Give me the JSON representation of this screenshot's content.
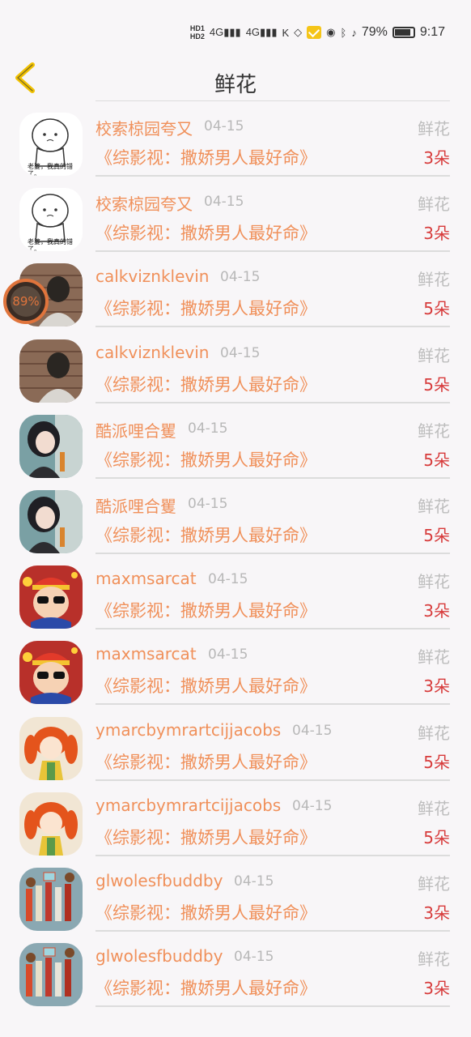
{
  "status_bar": {
    "hd1": "HD1",
    "hd2": "HD2",
    "sig1": "4G",
    "sig2": "4G",
    "battery": "79%",
    "time": "9:17"
  },
  "header": {
    "title": "鲜花"
  },
  "badge": {
    "percent": "89%"
  },
  "rows": [
    {
      "name": "",
      "date": "",
      "type": "",
      "work": "《综影视：撒娇男人最好命》",
      "count": "3朵",
      "avatar": "dark"
    },
    {
      "name": "校索椋园夸又",
      "date": "04-15",
      "type": "鲜花",
      "work": "《综影视：撒娇男人最好命》",
      "count": "3朵",
      "avatar": "meme",
      "avatar_text": "老婆，我真的错了。"
    },
    {
      "name": "校索椋园夸又",
      "date": "04-15",
      "type": "鲜花",
      "work": "《综影视：撒娇男人最好命》",
      "count": "3朵",
      "avatar": "meme",
      "avatar_text": "老婆，我真的错了。"
    },
    {
      "name": "calkviznklevin",
      "date": "04-15",
      "type": "鲜花",
      "work": "《综影视：撒娇男人最好命》",
      "count": "5朵",
      "avatar": "brick"
    },
    {
      "name": "calkviznklevin",
      "date": "04-15",
      "type": "鲜花",
      "work": "《综影视：撒娇男人最好命》",
      "count": "5朵",
      "avatar": "brick"
    },
    {
      "name": "酷派哩合矍",
      "date": "04-15",
      "type": "鲜花",
      "work": "《综影视：撒娇男人最好命》",
      "count": "5朵",
      "avatar": "girl"
    },
    {
      "name": "酷派哩合矍",
      "date": "04-15",
      "type": "鲜花",
      "work": "《综影视：撒娇男人最好命》",
      "count": "5朵",
      "avatar": "girl"
    },
    {
      "name": "maxmsarcat",
      "date": "04-15",
      "type": "鲜花",
      "work": "《综影视：撒娇男人最好命》",
      "count": "3朵",
      "avatar": "cartoon"
    },
    {
      "name": "maxmsarcat",
      "date": "04-15",
      "type": "鲜花",
      "work": "《综影视：撒娇男人最好命》",
      "count": "3朵",
      "avatar": "cartoon"
    },
    {
      "name": "ymarcbymrartcijjacobs",
      "date": "04-15",
      "type": "鲜花",
      "work": "《综影视：撒娇男人最好命》",
      "count": "5朵",
      "avatar": "redhair"
    },
    {
      "name": "ymarcbymrartcijjacobs",
      "date": "04-15",
      "type": "鲜花",
      "work": "《综影视：撒娇男人最好命》",
      "count": "5朵",
      "avatar": "redhair"
    },
    {
      "name": "glwolesfbuddby",
      "date": "04-15",
      "type": "鲜花",
      "work": "《综影视：撒娇男人最好命》",
      "count": "3朵",
      "avatar": "pencils"
    },
    {
      "name": "glwolesfbuddby",
      "date": "04-15",
      "type": "鲜花",
      "work": "《综影视：撒娇男人最好命》",
      "count": "3朵",
      "avatar": "pencils"
    }
  ]
}
